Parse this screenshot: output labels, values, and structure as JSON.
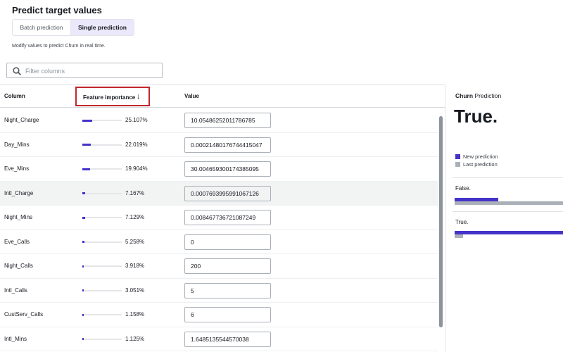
{
  "page": {
    "title": "Predict target values",
    "helper_text": "Modify values to predict Churn in real time."
  },
  "mode_tabs": [
    {
      "label": "Batch prediction",
      "selected": false
    },
    {
      "label": "Single prediction",
      "selected": true
    }
  ],
  "filter": {
    "placeholder": "Filter columns",
    "value": "",
    "icon": "search-icon"
  },
  "table": {
    "headers": {
      "column": "Column",
      "feature_importance": "Feature importance",
      "sort_icon": "arrow-down-icon",
      "value": "Value"
    },
    "rows": [
      {
        "column": "Night_Charge",
        "importance": "25.107%",
        "importance_value": 25.107,
        "value": "10.05486252011786785",
        "highlighted": false
      },
      {
        "column": "Day_Mins",
        "importance": "22.019%",
        "importance_value": 22.019,
        "value": "0.00021480176744415047",
        "highlighted": false
      },
      {
        "column": "Eve_Mins",
        "importance": "19.904%",
        "importance_value": 19.904,
        "value": "30.004659300174385095",
        "highlighted": false
      },
      {
        "column": "Intl_Charge",
        "importance": "7.167%",
        "importance_value": 7.167,
        "value": "0.0007693995991067126",
        "highlighted": true
      },
      {
        "column": "Night_Mins",
        "importance": "7.129%",
        "importance_value": 7.129,
        "value": "0.008467736721087249",
        "highlighted": false
      },
      {
        "column": "Eve_Calls",
        "importance": "5.258%",
        "importance_value": 5.258,
        "value": "0",
        "highlighted": false
      },
      {
        "column": "Night_Calls",
        "importance": "3.918%",
        "importance_value": 3.918,
        "value": "200",
        "highlighted": false
      },
      {
        "column": "Intl_Calls",
        "importance": "3.051%",
        "importance_value": 3.051,
        "value": "5",
        "highlighted": false
      },
      {
        "column": "CustServ_Calls",
        "importance": "1.158%",
        "importance_value": 1.158,
        "value": "6",
        "highlighted": false
      },
      {
        "column": "Intl_Mins",
        "importance": "1.125%",
        "importance_value": 1.125,
        "value": "1.6485135544570038",
        "highlighted": false
      }
    ]
  },
  "prediction_panel": {
    "heading_bold": "Churn",
    "heading_rest": "Prediction",
    "result": "True.",
    "legend": [
      {
        "label": "New prediction",
        "color": "#4433c8"
      },
      {
        "label": "Last prediction",
        "color": "#aab0b8"
      }
    ],
    "classes": [
      {
        "label": "False.",
        "new_probability": 0.4,
        "last_probability": 1.0
      },
      {
        "label": "True.",
        "new_probability": 1.0,
        "last_probability": 0.08
      }
    ]
  },
  "colors": {
    "accent": "#4433c8",
    "last": "#aab0b8",
    "highlight_box": "#c1272d"
  }
}
